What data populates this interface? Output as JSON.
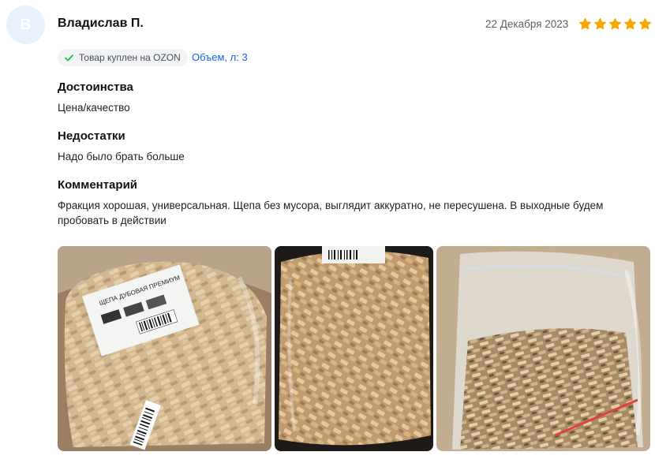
{
  "review": {
    "avatar_letter": "В",
    "author": "Владислав П.",
    "date": "22 Декабря 2023",
    "rating": 5,
    "max_rating": 5,
    "star_color": "#f9a600",
    "verified_badge": "Товар куплен на OZON",
    "variant": "Объем, л: 3",
    "sections": {
      "pros": {
        "title": "Достоинства",
        "text": "Цена/качество"
      },
      "cons": {
        "title": "Недостатки",
        "text": "Надо было брать больше"
      },
      "comment": {
        "title": "Комментарий",
        "text": "Фракция хорошая, универсальная. Щепа без мусора, выглядит аккуратно, не пересушена. В выходные будем пробовать в действии"
      }
    },
    "photos": [
      {
        "label": "ЩЕПА ДУБОВАЯ ПРЕМИУМ"
      },
      {
        "label": ""
      },
      {
        "label": ""
      }
    ]
  }
}
